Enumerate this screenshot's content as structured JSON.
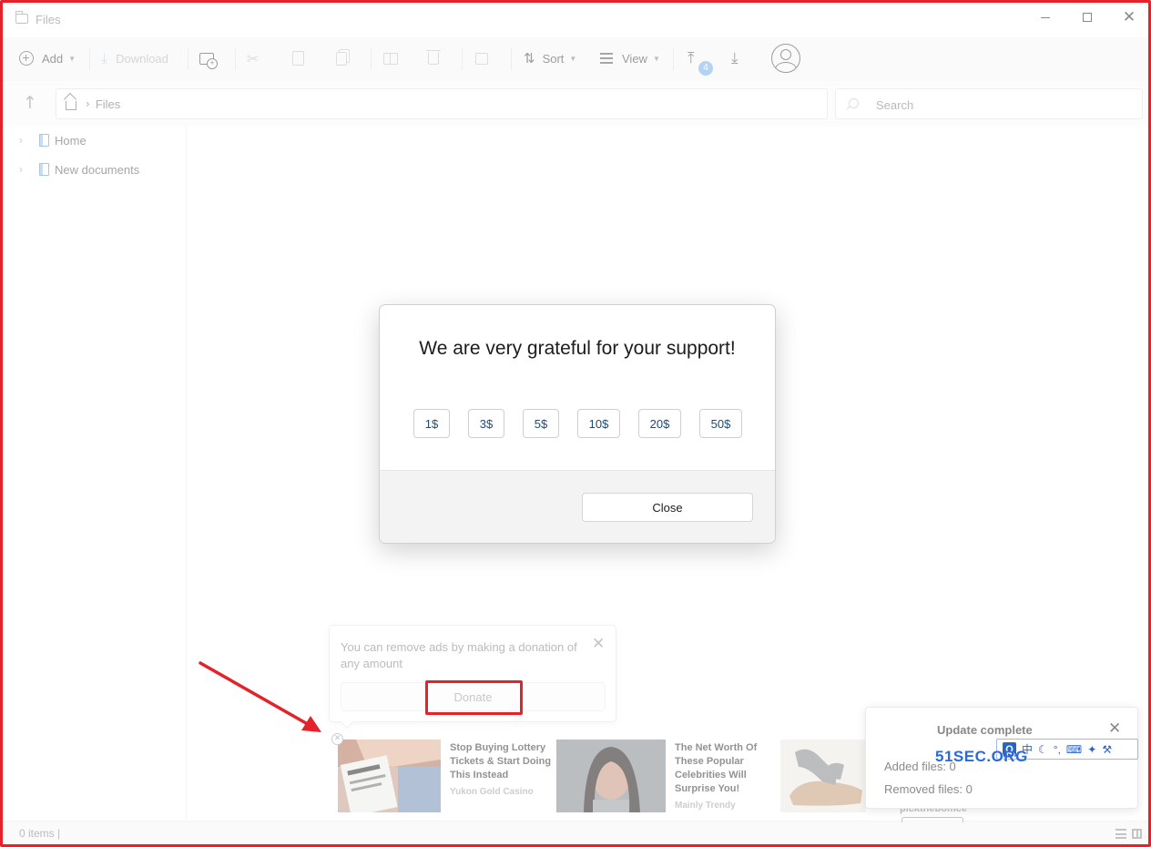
{
  "window": {
    "title": "Files",
    "controls": [
      "minimize-icon",
      "maximize-icon",
      "close-icon"
    ]
  },
  "toolbar": {
    "add_label": "Add",
    "download_label": "Download",
    "sort_label": "Sort",
    "view_label": "View",
    "upload_badge": "4",
    "icons": [
      "circle-plus-icon",
      "download-arrow-icon",
      "new-folder-icon",
      "cut-icon",
      "copy-icon",
      "paste-icon",
      "rename-icon",
      "trash-icon",
      "share-icon",
      "sort-icon",
      "view-list-icon",
      "upload-icon",
      "download-icon",
      "user-avatar-icon"
    ]
  },
  "pathbar": {
    "crumbs": [
      "Files"
    ],
    "search_placeholder": "Search"
  },
  "sidebar": {
    "items": [
      {
        "label": "Home"
      },
      {
        "label": "New documents"
      }
    ]
  },
  "modal": {
    "title": "We are very grateful for your support!",
    "amounts": [
      "1$",
      "3$",
      "5$",
      "10$",
      "20$",
      "50$"
    ],
    "close_label": "Close"
  },
  "donation_tip": {
    "text": "You can remove ads by making a donation of any amount",
    "donate_label": "Donate"
  },
  "ads": [
    {
      "title": "Stop Buying Lottery Tickets & Start Doing This Instead",
      "source": "Yukon Gold Casino"
    },
    {
      "title": "The Net Worth Of These Popular Celebrities Will Surprise You!",
      "source": "Mainly Trendy"
    }
  ],
  "ad_peek_source": "pickthebomce",
  "update_toast": {
    "title": "Update complete",
    "added": "Added files:  0",
    "removed": "Removed files:  0"
  },
  "ime_bar": {
    "items": [
      "中",
      "°,",
      "⌨"
    ]
  },
  "watermark": "51SEC.ORG",
  "status": {
    "text": "0 items |"
  },
  "colors": {
    "annotation_red": "#e3222a",
    "accent_blue": "#1a4a7e",
    "badge_blue": "#7fb2ea"
  }
}
